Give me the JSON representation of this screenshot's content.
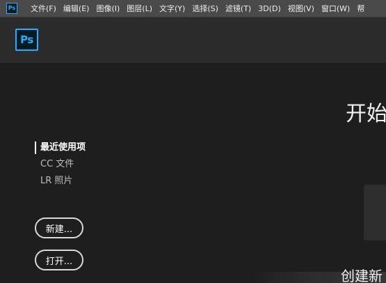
{
  "menubar": {
    "app_icon": "Ps",
    "items": [
      {
        "label": "文件(F)"
      },
      {
        "label": "编辑(E)"
      },
      {
        "label": "图像(I)"
      },
      {
        "label": "图层(L)"
      },
      {
        "label": "文字(Y)"
      },
      {
        "label": "选择(S)"
      },
      {
        "label": "滤镜(T)"
      },
      {
        "label": "3D(D)"
      },
      {
        "label": "视图(V)"
      },
      {
        "label": "窗口(W)"
      },
      {
        "label": "帮"
      }
    ]
  },
  "header": {
    "logo_text": "Ps"
  },
  "sidebar": {
    "items": [
      {
        "label": "最近使用项",
        "active": true
      },
      {
        "label": "CC 文件",
        "active": false
      },
      {
        "label": "LR 照片",
        "active": false
      }
    ],
    "new_button": "新建...",
    "open_button": "打开..."
  },
  "main": {
    "start_heading": "开始",
    "create_heading": "创建新"
  },
  "colors": {
    "accent": "#31a8ff",
    "menubar_bg": "#4a4a4a",
    "header_bg": "#2b2b2b",
    "main_bg": "#1e1e1e"
  }
}
